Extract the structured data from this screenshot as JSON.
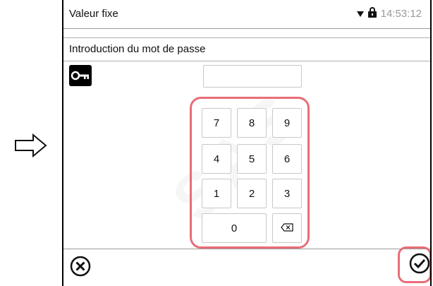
{
  "header": {
    "title": "Valeur fixe",
    "time": "14:53:12"
  },
  "dialog": {
    "title": "Introduction du mot de passe",
    "password_value": ""
  },
  "keypad": {
    "k7": "7",
    "k8": "8",
    "k9": "9",
    "k4": "4",
    "k5": "5",
    "k6": "6",
    "k1": "1",
    "k2": "2",
    "k3": "3",
    "k0": "0"
  },
  "colors": {
    "highlight": "#e86d78",
    "border": "#c8c8c8"
  },
  "icons": [
    "right-arrow-icon",
    "dropdown-icon",
    "lock-icon",
    "key-icon",
    "backspace-icon",
    "cancel-icon",
    "confirm-icon"
  ]
}
